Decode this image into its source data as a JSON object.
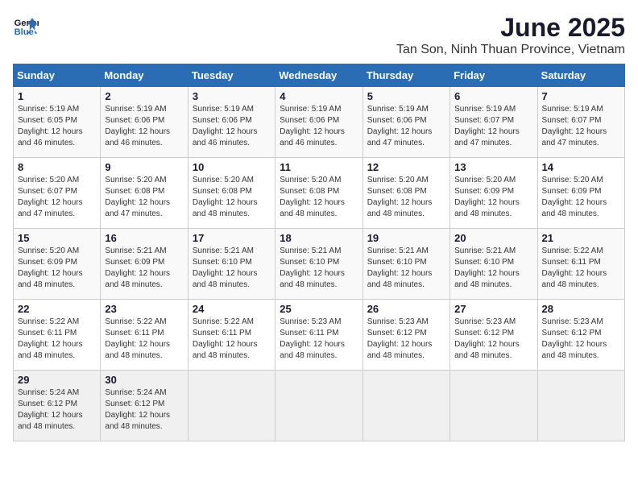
{
  "logo": {
    "line1": "General",
    "line2": "Blue"
  },
  "title": "June 2025",
  "subtitle": "Tan Son, Ninh Thuan Province, Vietnam",
  "weekdays": [
    "Sunday",
    "Monday",
    "Tuesday",
    "Wednesday",
    "Thursday",
    "Friday",
    "Saturday"
  ],
  "weeks": [
    [
      {
        "day": "1",
        "detail": "Sunrise: 5:19 AM\nSunset: 6:05 PM\nDaylight: 12 hours\nand 46 minutes."
      },
      {
        "day": "2",
        "detail": "Sunrise: 5:19 AM\nSunset: 6:06 PM\nDaylight: 12 hours\nand 46 minutes."
      },
      {
        "day": "3",
        "detail": "Sunrise: 5:19 AM\nSunset: 6:06 PM\nDaylight: 12 hours\nand 46 minutes."
      },
      {
        "day": "4",
        "detail": "Sunrise: 5:19 AM\nSunset: 6:06 PM\nDaylight: 12 hours\nand 46 minutes."
      },
      {
        "day": "5",
        "detail": "Sunrise: 5:19 AM\nSunset: 6:06 PM\nDaylight: 12 hours\nand 47 minutes."
      },
      {
        "day": "6",
        "detail": "Sunrise: 5:19 AM\nSunset: 6:07 PM\nDaylight: 12 hours\nand 47 minutes."
      },
      {
        "day": "7",
        "detail": "Sunrise: 5:19 AM\nSunset: 6:07 PM\nDaylight: 12 hours\nand 47 minutes."
      }
    ],
    [
      {
        "day": "8",
        "detail": "Sunrise: 5:20 AM\nSunset: 6:07 PM\nDaylight: 12 hours\nand 47 minutes."
      },
      {
        "day": "9",
        "detail": "Sunrise: 5:20 AM\nSunset: 6:08 PM\nDaylight: 12 hours\nand 47 minutes."
      },
      {
        "day": "10",
        "detail": "Sunrise: 5:20 AM\nSunset: 6:08 PM\nDaylight: 12 hours\nand 48 minutes."
      },
      {
        "day": "11",
        "detail": "Sunrise: 5:20 AM\nSunset: 6:08 PM\nDaylight: 12 hours\nand 48 minutes."
      },
      {
        "day": "12",
        "detail": "Sunrise: 5:20 AM\nSunset: 6:08 PM\nDaylight: 12 hours\nand 48 minutes."
      },
      {
        "day": "13",
        "detail": "Sunrise: 5:20 AM\nSunset: 6:09 PM\nDaylight: 12 hours\nand 48 minutes."
      },
      {
        "day": "14",
        "detail": "Sunrise: 5:20 AM\nSunset: 6:09 PM\nDaylight: 12 hours\nand 48 minutes."
      }
    ],
    [
      {
        "day": "15",
        "detail": "Sunrise: 5:20 AM\nSunset: 6:09 PM\nDaylight: 12 hours\nand 48 minutes."
      },
      {
        "day": "16",
        "detail": "Sunrise: 5:21 AM\nSunset: 6:09 PM\nDaylight: 12 hours\nand 48 minutes."
      },
      {
        "day": "17",
        "detail": "Sunrise: 5:21 AM\nSunset: 6:10 PM\nDaylight: 12 hours\nand 48 minutes."
      },
      {
        "day": "18",
        "detail": "Sunrise: 5:21 AM\nSunset: 6:10 PM\nDaylight: 12 hours\nand 48 minutes."
      },
      {
        "day": "19",
        "detail": "Sunrise: 5:21 AM\nSunset: 6:10 PM\nDaylight: 12 hours\nand 48 minutes."
      },
      {
        "day": "20",
        "detail": "Sunrise: 5:21 AM\nSunset: 6:10 PM\nDaylight: 12 hours\nand 48 minutes."
      },
      {
        "day": "21",
        "detail": "Sunrise: 5:22 AM\nSunset: 6:11 PM\nDaylight: 12 hours\nand 48 minutes."
      }
    ],
    [
      {
        "day": "22",
        "detail": "Sunrise: 5:22 AM\nSunset: 6:11 PM\nDaylight: 12 hours\nand 48 minutes."
      },
      {
        "day": "23",
        "detail": "Sunrise: 5:22 AM\nSunset: 6:11 PM\nDaylight: 12 hours\nand 48 minutes."
      },
      {
        "day": "24",
        "detail": "Sunrise: 5:22 AM\nSunset: 6:11 PM\nDaylight: 12 hours\nand 48 minutes."
      },
      {
        "day": "25",
        "detail": "Sunrise: 5:23 AM\nSunset: 6:11 PM\nDaylight: 12 hours\nand 48 minutes."
      },
      {
        "day": "26",
        "detail": "Sunrise: 5:23 AM\nSunset: 6:12 PM\nDaylight: 12 hours\nand 48 minutes."
      },
      {
        "day": "27",
        "detail": "Sunrise: 5:23 AM\nSunset: 6:12 PM\nDaylight: 12 hours\nand 48 minutes."
      },
      {
        "day": "28",
        "detail": "Sunrise: 5:23 AM\nSunset: 6:12 PM\nDaylight: 12 hours\nand 48 minutes."
      }
    ],
    [
      {
        "day": "29",
        "detail": "Sunrise: 5:24 AM\nSunset: 6:12 PM\nDaylight: 12 hours\nand 48 minutes."
      },
      {
        "day": "30",
        "detail": "Sunrise: 5:24 AM\nSunset: 6:12 PM\nDaylight: 12 hours\nand 48 minutes."
      },
      {
        "day": "",
        "detail": ""
      },
      {
        "day": "",
        "detail": ""
      },
      {
        "day": "",
        "detail": ""
      },
      {
        "day": "",
        "detail": ""
      },
      {
        "day": "",
        "detail": ""
      }
    ]
  ]
}
